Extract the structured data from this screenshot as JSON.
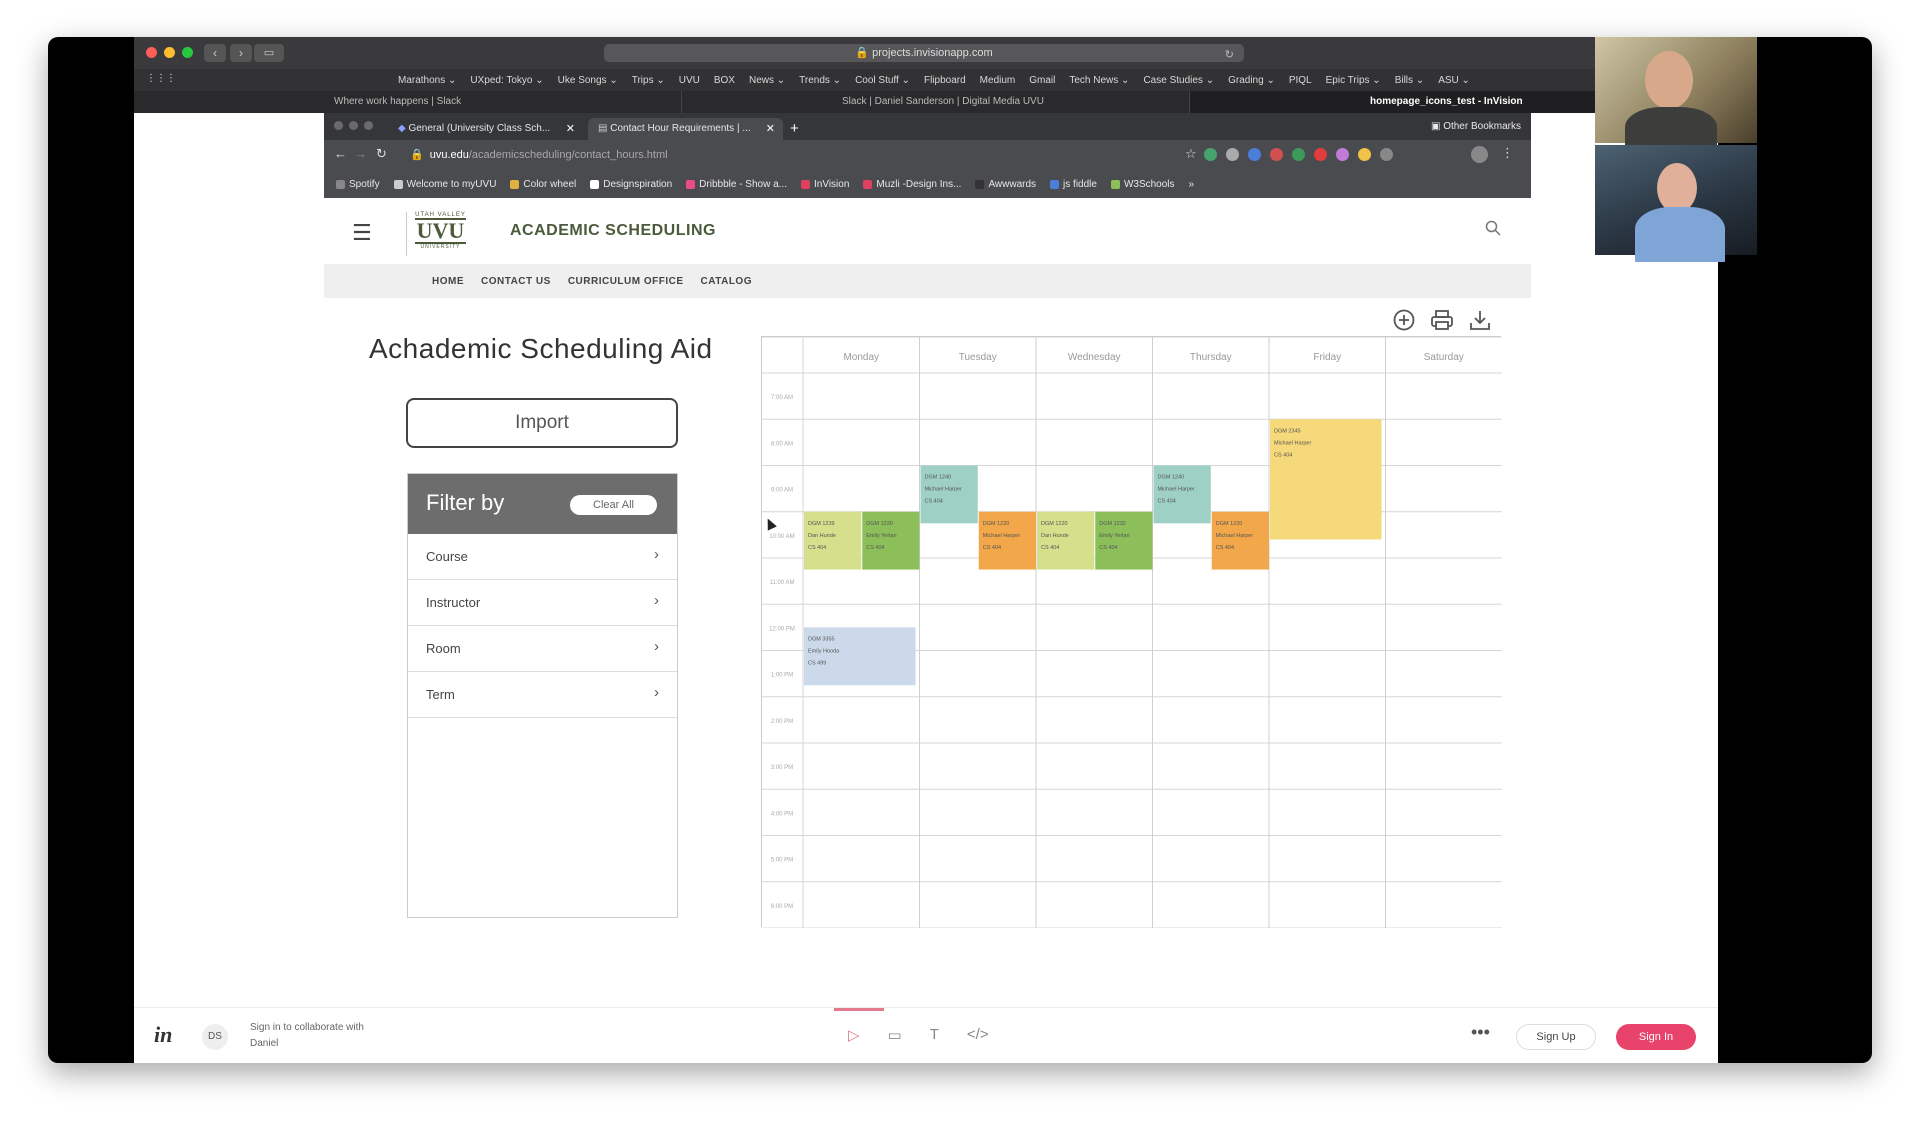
{
  "outer_browser": {
    "url": "projects.invisionapp.com",
    "bookmarks": [
      "Marathons ⌄",
      "UXped: Tokyo ⌄",
      "Uke Songs ⌄",
      "Trips ⌄",
      "UVU",
      "BOX",
      "News ⌄",
      "Trends ⌄",
      "Cool Stuff ⌄",
      "Flipboard",
      "Medium",
      "Gmail",
      "Tech News ⌄",
      "Case Studies ⌄",
      "Grading ⌄",
      "PIQL",
      "Epic Trips ⌄",
      "Bills ⌄",
      "ASU ⌄"
    ],
    "tabs": [
      "Where work happens | Slack",
      "Slack | Daniel Sanderson | Digital Media UVU",
      "homepage_icons_test - InVision"
    ]
  },
  "chrome": {
    "tab1": "General (University Class Sch...",
    "tab2": "Contact Hour Requirements | ...",
    "url_host": "uvu.edu",
    "url_path": "/academicscheduling/contact_hours.html",
    "bookmarks": [
      "Spotify",
      "Welcome to myUVU",
      "Color wheel",
      "Designspiration",
      "Dribbble - Show a...",
      "InVision",
      "Muzli -Design Ins...",
      "Awwwards",
      "js fiddle",
      "W3Schools"
    ],
    "more": "»",
    "other_bookmarks": "Other Bookmarks"
  },
  "site": {
    "logo_top": "UTAH VALLEY",
    "logo": "UVU",
    "logo_bottom": "UNIVERSITY",
    "title": "ACADEMIC SCHEDULING",
    "nav": [
      "HOME",
      "CONTACT US",
      "CURRICULUM OFFICE",
      "CATALOG"
    ],
    "page_title": "Achademic Scheduling Aid",
    "import_label": "Import",
    "filter": {
      "title": "Filter by",
      "clear_label": "Clear All",
      "rows": [
        "Course",
        "Instructor",
        "Room",
        "Term"
      ],
      "chevron": "›"
    }
  },
  "calendar": {
    "days": [
      "Monday",
      "Tuesday",
      "Wednesday",
      "Thursday",
      "Friday",
      "Saturday"
    ],
    "times": [
      "7:00 AM",
      "8:00 AM",
      "9:00 AM",
      "10:00 AM",
      "11:00 AM",
      "12:00 PM",
      "1:00 PM",
      "2:00 PM",
      "3:00 PM",
      "4:00 PM",
      "5:00 PM",
      "6:00 PM"
    ],
    "events": [
      {
        "day": 0,
        "start": 3,
        "end": 4.25,
        "half": 0,
        "color": "#d6e08c",
        "lines": [
          "DGM 1239",
          "Dan Hunde",
          "CS 404"
        ]
      },
      {
        "day": 0,
        "start": 3,
        "end": 4.25,
        "half": 1,
        "color": "#8cbf5a",
        "lines": [
          "DGM 1230",
          "Emily Yerlan",
          "CS 404"
        ]
      },
      {
        "day": 1,
        "start": 2,
        "end": 3.25,
        "half": 0,
        "color": "#9fd0c6",
        "lines": [
          "DGM 1240",
          "Michael Harper",
          "CS 404"
        ]
      },
      {
        "day": 1,
        "start": 3,
        "end": 4.25,
        "half": 1,
        "color": "#f2a84a",
        "lines": [
          "DGM 1220",
          "Michael Harper",
          "CS 404"
        ]
      },
      {
        "day": 2,
        "start": 3,
        "end": 4.25,
        "half": 0,
        "color": "#d6e08c",
        "lines": [
          "DGM 1220",
          "Dan Hunde",
          "CS 404"
        ]
      },
      {
        "day": 2,
        "start": 3,
        "end": 4.25,
        "half": 1,
        "color": "#8cbf5a",
        "lines": [
          "DGM 1232",
          "Emily Yerlan",
          "CS 404"
        ]
      },
      {
        "day": 3,
        "start": 2,
        "end": 3.25,
        "half": 0,
        "color": "#9fd0c6",
        "lines": [
          "DGM 1240",
          "Michael Harper",
          "CS 404"
        ]
      },
      {
        "day": 3,
        "start": 3,
        "end": 4.25,
        "half": 1,
        "color": "#f2a84a",
        "lines": [
          "DGM 1220",
          "Michael Harper",
          "CS 404"
        ]
      },
      {
        "day": 4,
        "start": 1,
        "end": 3.6,
        "half": -1,
        "color": "#f5d97a",
        "lines": [
          "DGM 2345",
          "Michael Harper",
          "CS 404"
        ]
      },
      {
        "day": 0,
        "start": 5.5,
        "end": 6.75,
        "half": -1,
        "color": "#cbd9ea",
        "lines": [
          "DGM 3355",
          "Emily Hooda",
          "CS 499"
        ]
      }
    ]
  },
  "invision": {
    "logo": "in",
    "user_initials": "DS",
    "sign_in_text": "Sign in to collaborate with Daniel",
    "more": "•••",
    "sign_up": "Sign Up",
    "sign_in": "Sign In",
    "accent": "#e8436b"
  }
}
